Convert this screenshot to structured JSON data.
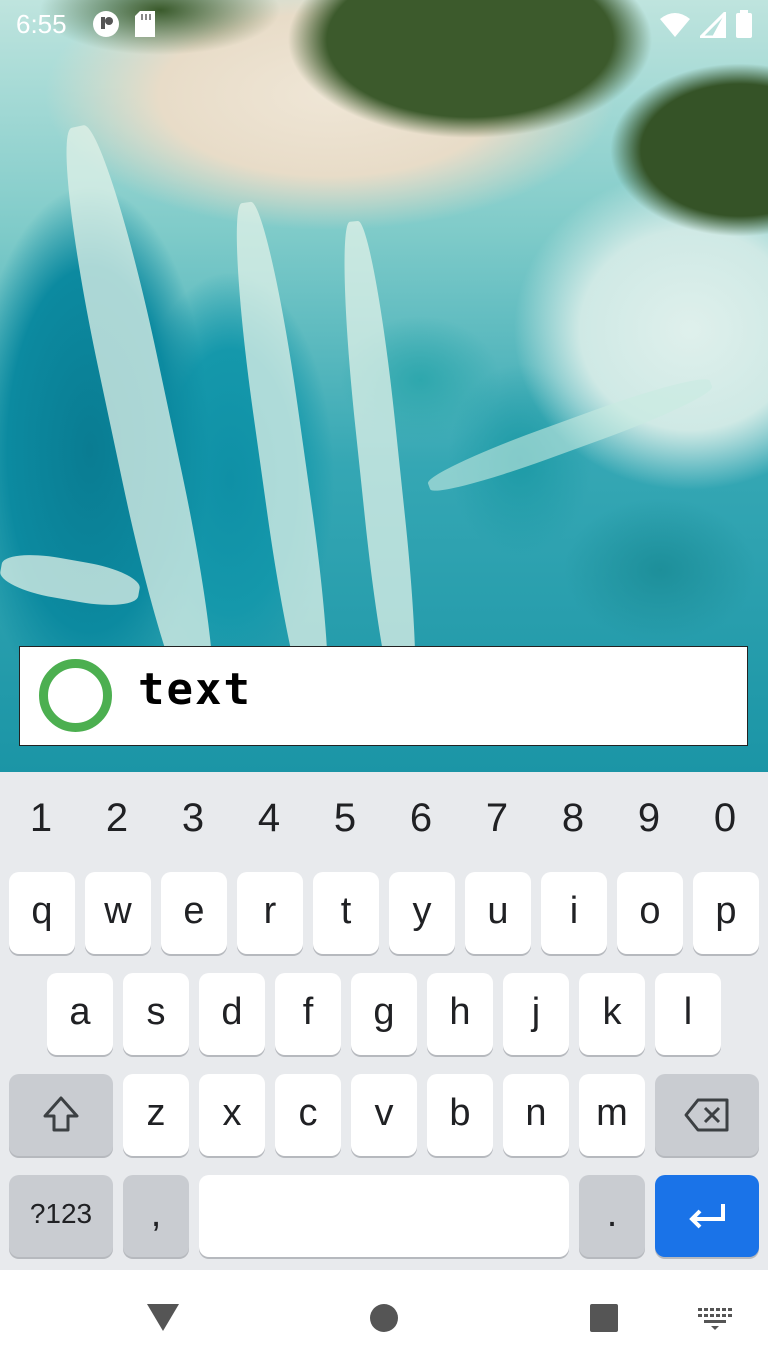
{
  "status_bar": {
    "time": "6:55",
    "left_icons": [
      "privacy-indicator-icon",
      "sd-card-icon"
    ],
    "right_icons": [
      "wifi-icon",
      "cell-signal-icon",
      "battery-icon"
    ]
  },
  "text_field": {
    "value": "text",
    "leading_icon": "green-ring-icon",
    "accent_color": "#4caf50"
  },
  "keyboard": {
    "number_row": [
      "1",
      "2",
      "3",
      "4",
      "5",
      "6",
      "7",
      "8",
      "9",
      "0"
    ],
    "row1": [
      "q",
      "w",
      "e",
      "r",
      "t",
      "y",
      "u",
      "i",
      "o",
      "p"
    ],
    "row2": [
      "a",
      "s",
      "d",
      "f",
      "g",
      "h",
      "j",
      "k",
      "l"
    ],
    "row3": [
      "z",
      "x",
      "c",
      "v",
      "b",
      "n",
      "m"
    ],
    "symbols_label": "?123",
    "comma": ",",
    "period": ".",
    "icons": [
      "shift-icon",
      "backspace-icon",
      "enter-icon"
    ],
    "enter_color": "#1a73e8"
  },
  "nav_bar": {
    "icons": [
      "back-icon",
      "home-icon",
      "recents-icon",
      "keyboard-switch-icon"
    ]
  }
}
